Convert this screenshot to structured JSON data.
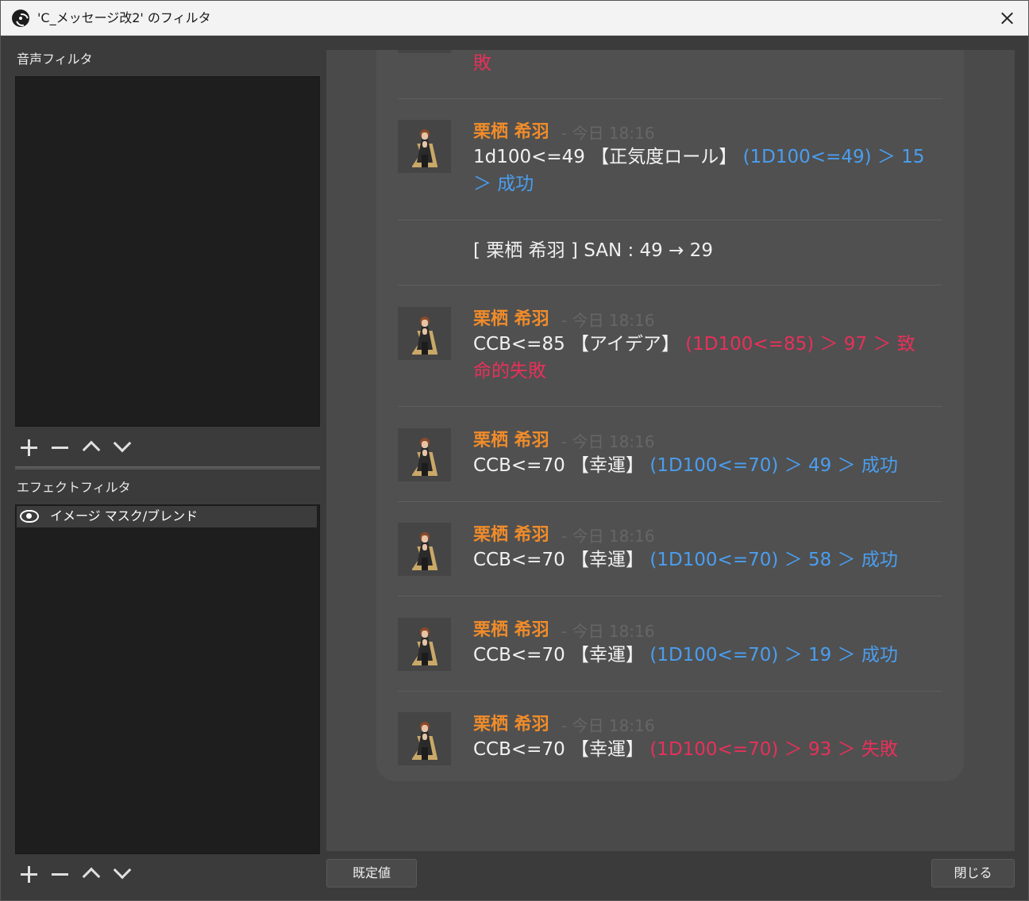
{
  "window": {
    "title": "'C_メッセージ改2' のフィルタ"
  },
  "audio_filters": {
    "label": "音声フィルタ"
  },
  "effect_filters": {
    "label": "エフェクトフィルタ",
    "items": [
      {
        "label": "イメージ マスク/ブレンド",
        "visible": true
      }
    ]
  },
  "chat": {
    "top_fragment": "敗",
    "messages": [
      {
        "name": "栗栖 希羽",
        "meta": "- 今日 18:16",
        "command": "1d100<=49 【正気度ロール】",
        "result_line1": "(1D100<=49) ＞ 15",
        "result_line2": "＞ 成功",
        "result_color": "blue"
      },
      {
        "system": "[ 栗栖 希羽 ] SAN : 49 → 29"
      },
      {
        "name": "栗栖 希羽",
        "meta": "- 今日 18:16",
        "command": "CCB<=85 【アイデア】",
        "result_line1": "(1D100<=85) ＞ 97 ＞ 致",
        "result_line2": "命的失敗",
        "result_color": "red"
      },
      {
        "name": "栗栖 希羽",
        "meta": "- 今日 18:16",
        "command": "CCB<=70 【幸運】",
        "result_line1": "(1D100<=70) ＞ 49 ＞ 成功",
        "result_color": "blue"
      },
      {
        "name": "栗栖 希羽",
        "meta": "- 今日 18:16",
        "command": "CCB<=70 【幸運】",
        "result_line1": "(1D100<=70) ＞ 58 ＞ 成功",
        "result_color": "blue"
      },
      {
        "name": "栗栖 希羽",
        "meta": "- 今日 18:16",
        "command": "CCB<=70 【幸運】",
        "result_line1": "(1D100<=70) ＞ 19 ＞ 成功",
        "result_color": "blue"
      },
      {
        "name": "栗栖 希羽",
        "meta": "- 今日 18:16",
        "command": "CCB<=70 【幸運】",
        "result_line1": "(1D100<=70) ＞ 93 ＞ 失敗",
        "result_color": "red"
      }
    ]
  },
  "buttons": {
    "defaults": "既定値",
    "close": "閉じる"
  },
  "colors": {
    "name_orange": "#f08c2a",
    "success_blue": "#4a9ef0",
    "failure_red": "#e8305a"
  }
}
